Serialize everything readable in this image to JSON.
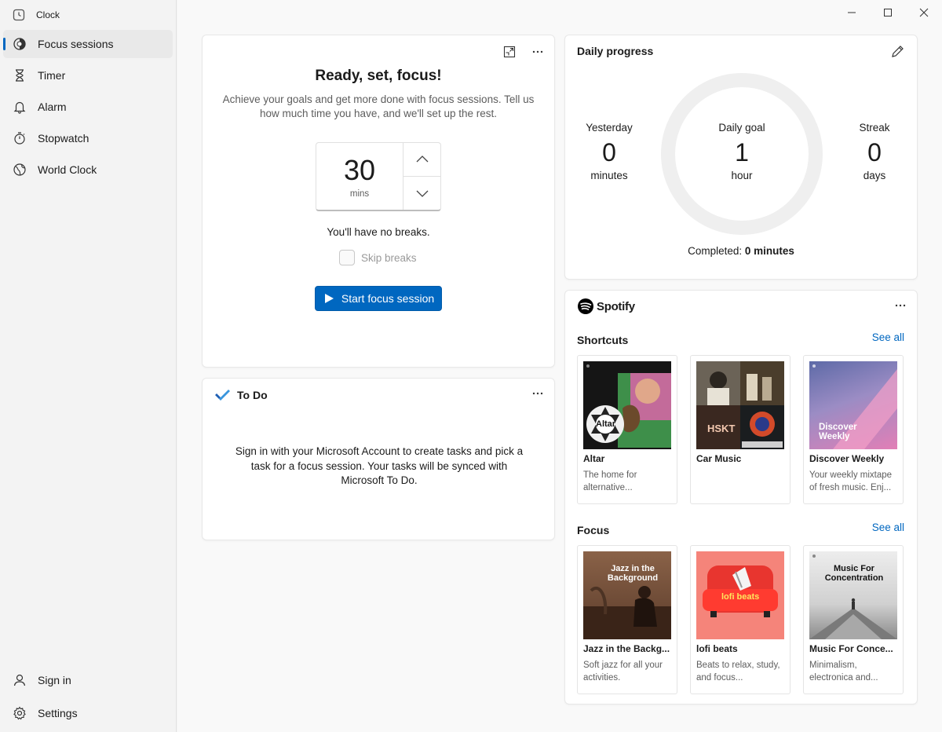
{
  "app": {
    "title": "Clock"
  },
  "nav": {
    "items": [
      {
        "label": "Focus sessions",
        "icon": "focus-icon",
        "active": true
      },
      {
        "label": "Timer",
        "icon": "hourglass-icon"
      },
      {
        "label": "Alarm",
        "icon": "bell-icon"
      },
      {
        "label": "Stopwatch",
        "icon": "stopwatch-icon"
      },
      {
        "label": "World Clock",
        "icon": "globe-icon"
      }
    ],
    "bottom": [
      {
        "label": "Sign in",
        "icon": "person-icon"
      },
      {
        "label": "Settings",
        "icon": "gear-icon"
      }
    ]
  },
  "focus": {
    "title": "Ready, set, focus!",
    "description": "Achieve your goals and get more done with focus sessions. Tell us how much time you have, and we'll set up the rest.",
    "time_value": "30",
    "time_unit": "mins",
    "breaks_text": "You'll have no breaks.",
    "skip_breaks_label": "Skip breaks",
    "start_label": "Start focus session"
  },
  "todo": {
    "title": "To Do",
    "message": "Sign in with your Microsoft Account to create tasks and pick a task for a focus session. Your tasks will be synced with Microsoft To Do."
  },
  "daily": {
    "title": "Daily progress",
    "yesterday": {
      "label": "Yesterday",
      "value": "0",
      "unit": "minutes"
    },
    "goal": {
      "label": "Daily goal",
      "value": "1",
      "unit": "hour"
    },
    "streak": {
      "label": "Streak",
      "value": "0",
      "unit": "days"
    },
    "completed_label": "Completed:",
    "completed_value": "0 minutes"
  },
  "spotify": {
    "brand": "Spotify",
    "shortcuts_title": "Shortcuts",
    "focus_title": "Focus",
    "see_all": "See all",
    "shortcuts": [
      {
        "name": "Altar",
        "sub": "The home for alternative...",
        "art_text": "Altar"
      },
      {
        "name": "Car Music",
        "sub": "",
        "art_text": "HSKT"
      },
      {
        "name": "Discover Weekly",
        "sub": "Your weekly mixtape of fresh music. Enj...",
        "art_text": "Discover Weekly"
      }
    ],
    "focus": [
      {
        "name": "Jazz in the Backg...",
        "sub": "Soft jazz for all your activities.",
        "art_text": "Jazz in the Background"
      },
      {
        "name": "lofi beats",
        "sub": "Beats to relax, study, and focus...",
        "art_text": "lofi beats"
      },
      {
        "name": "Music For Conce...",
        "sub": "Minimalism, electronica and...",
        "art_text": "Music For Concentration"
      }
    ]
  },
  "colors": {
    "accent": "#0067c0",
    "spotify_green": "#1db954"
  }
}
